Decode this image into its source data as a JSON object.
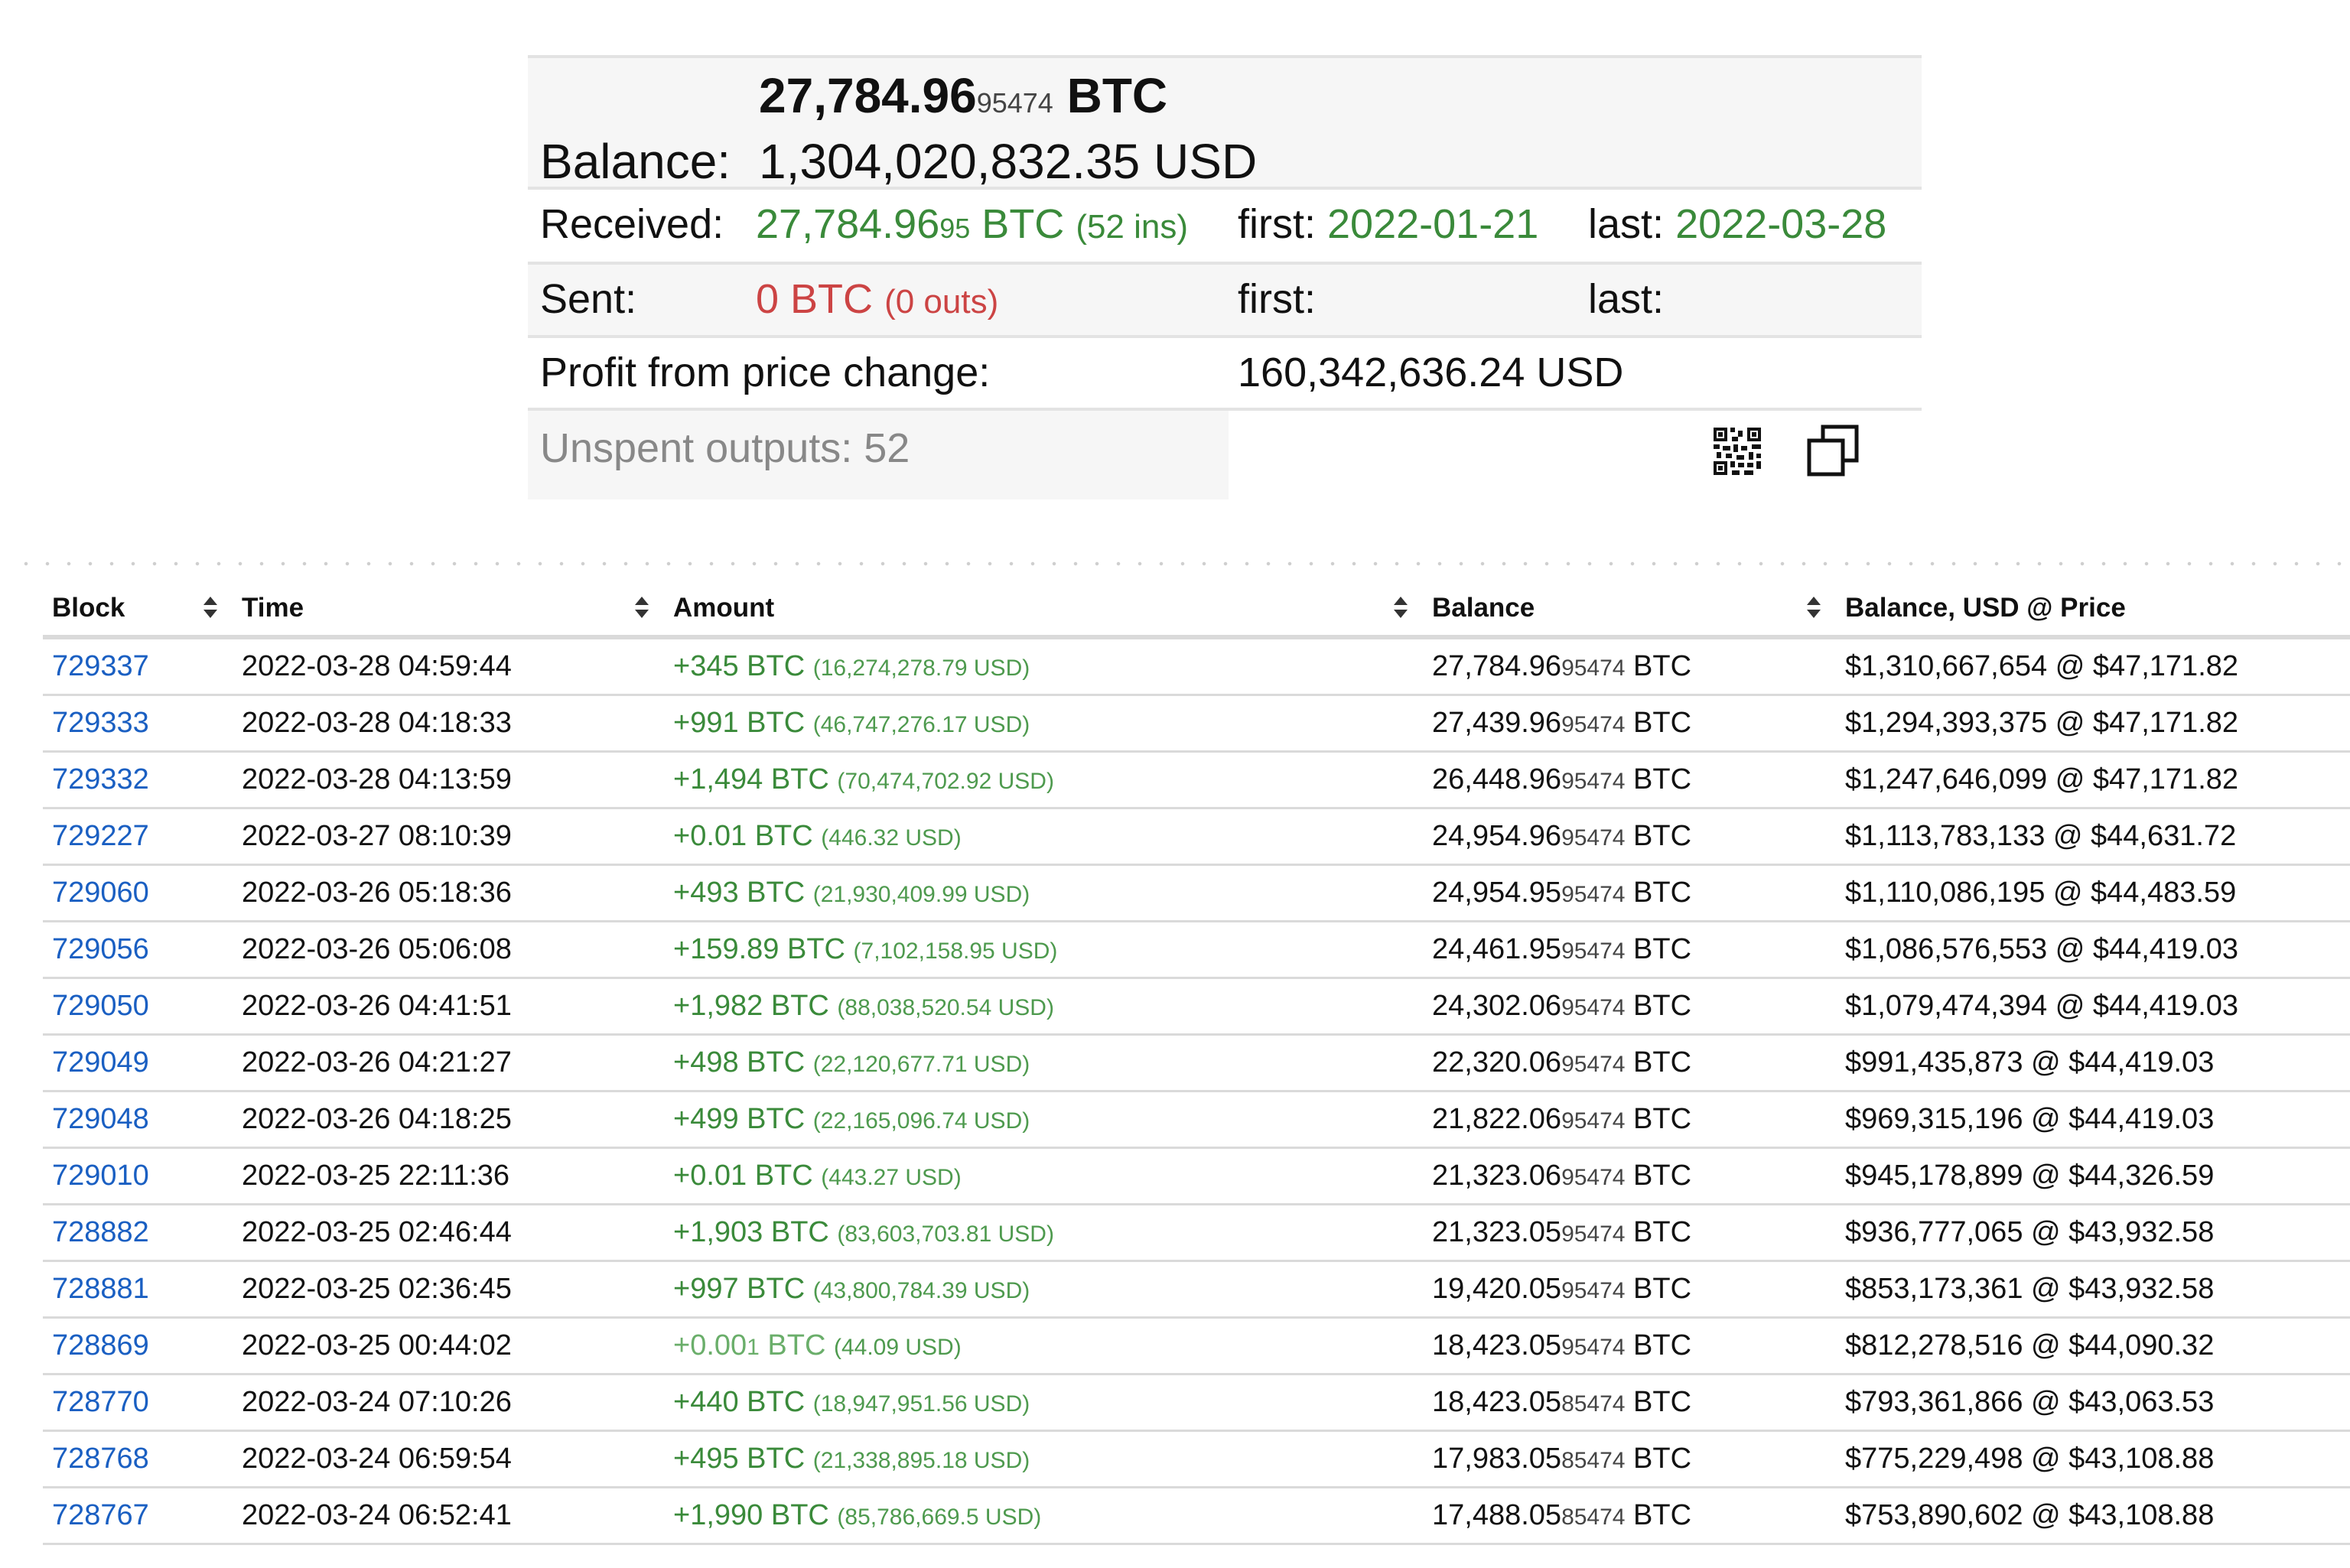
{
  "summary": {
    "btc_main": "27,784.96",
    "btc_small": "95474",
    "btc_unit": "BTC",
    "balance_label": "Balance:",
    "balance_usd": "1,304,020,832.35 USD",
    "received_label": "Received:",
    "received_main": "27,784.96",
    "received_small": "95",
    "received_unit": "BTC",
    "received_note": "(52 ins)",
    "received_first_label": "first:",
    "received_first": "2022-01-21",
    "received_last_label": "last:",
    "received_last": "2022-03-28",
    "sent_label": "Sent:",
    "sent_value": "0 BTC",
    "sent_note": "(0 outs)",
    "sent_first_label": "first:",
    "sent_last_label": "last:",
    "profit_label": "Profit from price change:",
    "profit_value": "160,342,636.24 USD",
    "unspent_label": "Unspent outputs: 52",
    "icons": {
      "qr": "qr-code-icon",
      "copy": "copy-icon"
    }
  },
  "table": {
    "headers": [
      "Block",
      "Time",
      "Amount",
      "Balance",
      "Balance, USD @ Price"
    ],
    "rows": [
      {
        "block": "729337",
        "time": "2022-03-28 04:59:44",
        "amt": "+345",
        "amt_small": "",
        "amt_unit": " BTC",
        "amt_usd": "(16,274,278.79 USD)",
        "bal": "27,784.96",
        "bal_small": "95474",
        "bal_unit": " BTC",
        "usd": "$1,310,667,654 @ $47,171.82"
      },
      {
        "block": "729333",
        "time": "2022-03-28 04:18:33",
        "amt": "+991",
        "amt_small": "",
        "amt_unit": " BTC",
        "amt_usd": "(46,747,276.17 USD)",
        "bal": "27,439.96",
        "bal_small": "95474",
        "bal_unit": " BTC",
        "usd": "$1,294,393,375 @ $47,171.82"
      },
      {
        "block": "729332",
        "time": "2022-03-28 04:13:59",
        "amt": "+1,494",
        "amt_small": "",
        "amt_unit": " BTC",
        "amt_usd": "(70,474,702.92 USD)",
        "bal": "26,448.96",
        "bal_small": "95474",
        "bal_unit": " BTC",
        "usd": "$1,247,646,099 @ $47,171.82"
      },
      {
        "block": "729227",
        "time": "2022-03-27 08:10:39",
        "amt": "+0.01",
        "amt_small": "",
        "amt_unit": " BTC",
        "amt_usd": "(446.32 USD)",
        "bal": "24,954.96",
        "bal_small": "95474",
        "bal_unit": " BTC",
        "usd": "$1,113,783,133 @ $44,631.72"
      },
      {
        "block": "729060",
        "time": "2022-03-26 05:18:36",
        "amt": "+493",
        "amt_small": "",
        "amt_unit": " BTC",
        "amt_usd": "(21,930,409.99 USD)",
        "bal": "24,954.95",
        "bal_small": "95474",
        "bal_unit": " BTC",
        "usd": "$1,110,086,195 @ $44,483.59"
      },
      {
        "block": "729056",
        "time": "2022-03-26 05:06:08",
        "amt": "+159.89",
        "amt_small": "",
        "amt_unit": " BTC",
        "amt_usd": "(7,102,158.95 USD)",
        "bal": "24,461.95",
        "bal_small": "95474",
        "bal_unit": " BTC",
        "usd": "$1,086,576,553 @ $44,419.03"
      },
      {
        "block": "729050",
        "time": "2022-03-26 04:41:51",
        "amt": "+1,982",
        "amt_small": "",
        "amt_unit": " BTC",
        "amt_usd": "(88,038,520.54 USD)",
        "bal": "24,302.06",
        "bal_small": "95474",
        "bal_unit": " BTC",
        "usd": "$1,079,474,394 @ $44,419.03"
      },
      {
        "block": "729049",
        "time": "2022-03-26 04:21:27",
        "amt": "+498",
        "amt_small": "",
        "amt_unit": " BTC",
        "amt_usd": "(22,120,677.71 USD)",
        "bal": "22,320.06",
        "bal_small": "95474",
        "bal_unit": " BTC",
        "usd": "$991,435,873 @ $44,419.03"
      },
      {
        "block": "729048",
        "time": "2022-03-26 04:18:25",
        "amt": "+499",
        "amt_small": "",
        "amt_unit": " BTC",
        "amt_usd": "(22,165,096.74 USD)",
        "bal": "21,822.06",
        "bal_small": "95474",
        "bal_unit": " BTC",
        "usd": "$969,315,196 @ $44,419.03"
      },
      {
        "block": "729010",
        "time": "2022-03-25 22:11:36",
        "amt": "+0.01",
        "amt_small": "",
        "amt_unit": " BTC",
        "amt_usd": "(443.27 USD)",
        "bal": "21,323.06",
        "bal_small": "95474",
        "bal_unit": " BTC",
        "usd": "$945,178,899 @ $44,326.59"
      },
      {
        "block": "728882",
        "time": "2022-03-25 02:46:44",
        "amt": "+1,903",
        "amt_small": "",
        "amt_unit": " BTC",
        "amt_usd": "(83,603,703.81 USD)",
        "bal": "21,323.05",
        "bal_small": "95474",
        "bal_unit": " BTC",
        "usd": "$936,777,065 @ $43,932.58"
      },
      {
        "block": "728881",
        "time": "2022-03-25 02:36:45",
        "amt": "+997",
        "amt_small": "",
        "amt_unit": " BTC",
        "amt_usd": "(43,800,784.39 USD)",
        "bal": "19,420.05",
        "bal_small": "95474",
        "bal_unit": " BTC",
        "usd": "$853,173,361 @ $43,932.58"
      },
      {
        "block": "728869",
        "time": "2022-03-25 00:44:02",
        "amt": "+0.00",
        "amt_small": "1",
        "amt_unit": " BTC",
        "amt_usd": "(44.09 USD)",
        "bal": "18,423.05",
        "bal_small": "95474",
        "bal_unit": " BTC",
        "usd": "$812,278,516 @ $44,090.32",
        "faded": true
      },
      {
        "block": "728770",
        "time": "2022-03-24 07:10:26",
        "amt": "+440",
        "amt_small": "",
        "amt_unit": " BTC",
        "amt_usd": "(18,947,951.56 USD)",
        "bal": "18,423.05",
        "bal_small": "85474",
        "bal_unit": " BTC",
        "usd": "$793,361,866 @ $43,063.53"
      },
      {
        "block": "728768",
        "time": "2022-03-24 06:59:54",
        "amt": "+495",
        "amt_small": "",
        "amt_unit": " BTC",
        "amt_usd": "(21,338,895.18 USD)",
        "bal": "17,983.05",
        "bal_small": "85474",
        "bal_unit": " BTC",
        "usd": "$775,229,498 @ $43,108.88"
      },
      {
        "block": "728767",
        "time": "2022-03-24 06:52:41",
        "amt": "+1,990",
        "amt_small": "",
        "amt_unit": " BTC",
        "amt_usd": "(85,786,669.5 USD)",
        "bal": "17,488.05",
        "bal_small": "85474",
        "bal_unit": " BTC",
        "usd": "$753,890,602 @ $43,108.88"
      }
    ]
  }
}
